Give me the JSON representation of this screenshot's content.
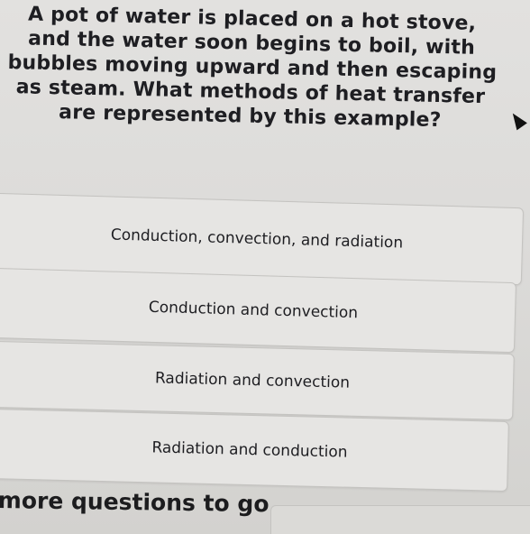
{
  "question": {
    "lines": [
      "A pot of water is placed on a hot stove,",
      "and the water soon begins to boil, with",
      "bubbles moving upward and then escaping",
      "as steam. What methods of heat transfer",
      "are represented by this example?"
    ]
  },
  "options": [
    {
      "label": "Conduction, convection, and radiation"
    },
    {
      "label": "Conduction and convection"
    },
    {
      "label": "Radiation and convection"
    },
    {
      "label": "Radiation and conduction"
    }
  ],
  "footer": {
    "progress_text": "more questions to go"
  }
}
